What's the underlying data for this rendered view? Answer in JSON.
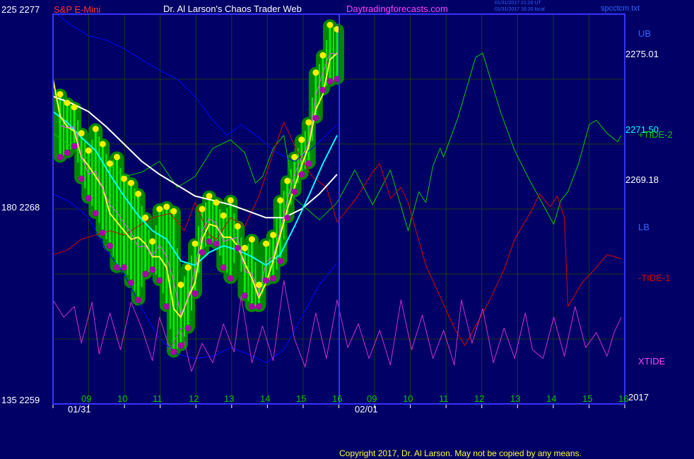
{
  "header": {
    "scale_top": "225  2277",
    "instrument": "S&P E-Mini",
    "site_title": "Dr. Al Larson's Chaos Trader Web",
    "site_url": "Daytradingforecasts.com",
    "timestamp_1": "01/31/2017 21:20 UT",
    "timestamp_2": "01/31/2017 16:20 local",
    "filename": "spcctcm.txt"
  },
  "left_scale": {
    "mid": "180  2268",
    "bottom": "135  2259"
  },
  "right_labels": {
    "ub": "UB",
    "ub_value": "2275.01",
    "mid_value_1": "2271.50",
    "tide2": "+TIDE-2",
    "mid_value_2": "2269.18",
    "lb": "LB",
    "tide1": "-TIDE-1",
    "xtide": "XTIDE",
    "year": "2017"
  },
  "x_axis": {
    "hours": [
      "09",
      "10",
      "11",
      "12",
      "13",
      "14",
      "15",
      "16",
      "09",
      "10",
      "11",
      "12",
      "13",
      "14",
      "15",
      "16"
    ],
    "date_1": "01/31",
    "date_2": "02/01"
  },
  "footer": {
    "copyright": "Copyright 2017, Dr. Al Larson. May not be copied by any means."
  },
  "colors": {
    "background": "#000066",
    "grid": "#1e3d10",
    "frame": "#3333ff",
    "price_glow": "#008800",
    "price_bars": "#00ee00",
    "highs": "#ffee00",
    "lows": "#aa00aa",
    "ema_fast": "#ffff33",
    "ema_mid": "#00ffff",
    "ema_slow": "#ffffff",
    "bands": "#0000ff",
    "tide2": "#00cc00",
    "tide1": "#dd0000",
    "xtide": "#cc33cc"
  },
  "chart_data": {
    "type": "line",
    "instrument": "S&P E-Mini",
    "y_axis": {
      "min": 2259,
      "max": 2277,
      "ticks": [
        2259,
        2268,
        2277
      ],
      "alt_ticks": [
        135,
        180,
        225
      ]
    },
    "x_axis": {
      "unit": "hour",
      "start": 8,
      "end": 16.1,
      "forecast_start": 16,
      "forecast_end": 24.1
    },
    "price_highs": [
      [
        8.2,
        2273.3
      ],
      [
        8.4,
        2272.9
      ],
      [
        8.6,
        2272.7
      ],
      [
        8.8,
        2271.5
      ],
      [
        9.0,
        2270.7
      ],
      [
        9.2,
        2271.7
      ],
      [
        9.4,
        2271.0
      ],
      [
        9.6,
        2270.1
      ],
      [
        9.8,
        2270.4
      ],
      [
        10.0,
        2269.4
      ],
      [
        10.2,
        2269.2
      ],
      [
        10.4,
        2268.7
      ],
      [
        10.6,
        2267.6
      ],
      [
        10.8,
        2266.5
      ],
      [
        11.0,
        2268.0
      ],
      [
        11.2,
        2268.1
      ],
      [
        11.4,
        2267.9
      ],
      [
        11.6,
        2264.5
      ],
      [
        11.8,
        2265.3
      ],
      [
        12.0,
        2266.4
      ],
      [
        12.2,
        2268.0
      ],
      [
        12.4,
        2268.6
      ],
      [
        12.6,
        2268.3
      ],
      [
        12.8,
        2267.7
      ],
      [
        13.0,
        2268.4
      ],
      [
        13.2,
        2267.2
      ],
      [
        13.4,
        2266.2
      ],
      [
        13.6,
        2266.6
      ],
      [
        13.8,
        2264.5
      ],
      [
        14.0,
        2266.4
      ],
      [
        14.2,
        2266.8
      ],
      [
        14.4,
        2268.4
      ],
      [
        14.6,
        2269.3
      ],
      [
        14.8,
        2270.4
      ],
      [
        15.0,
        2271.2
      ],
      [
        15.2,
        2272.0
      ],
      [
        15.4,
        2274.3
      ],
      [
        15.6,
        2275.1
      ],
      [
        15.8,
        2276.5
      ],
      [
        16.0,
        2276.3
      ]
    ],
    "price_lows": [
      [
        8.2,
        2270.4
      ],
      [
        8.4,
        2270.6
      ],
      [
        8.6,
        2270.9
      ],
      [
        8.8,
        2269.4
      ],
      [
        9.0,
        2268.5
      ],
      [
        9.2,
        2267.8
      ],
      [
        9.4,
        2266.9
      ],
      [
        9.6,
        2266.3
      ],
      [
        9.8,
        2265.3
      ],
      [
        10.0,
        2265.3
      ],
      [
        10.2,
        2264.6
      ],
      [
        10.4,
        2263.8
      ],
      [
        10.6,
        2265.0
      ],
      [
        10.8,
        2265.2
      ],
      [
        11.0,
        2264.7
      ],
      [
        11.2,
        2263.5
      ],
      [
        11.4,
        2261.4
      ],
      [
        11.6,
        2261.7
      ],
      [
        11.8,
        2262.5
      ],
      [
        12.0,
        2264.1
      ],
      [
        12.2,
        2266.0
      ],
      [
        12.4,
        2266.5
      ],
      [
        12.6,
        2266.4
      ],
      [
        12.8,
        2265.3
      ],
      [
        13.0,
        2264.8
      ],
      [
        13.2,
        2266.2
      ],
      [
        13.4,
        2264.0
      ],
      [
        13.6,
        2263.5
      ],
      [
        13.8,
        2263.5
      ],
      [
        14.0,
        2264.7
      ],
      [
        14.2,
        2264.8
      ],
      [
        14.4,
        2265.6
      ],
      [
        14.6,
        2267.6
      ],
      [
        14.8,
        2268.8
      ],
      [
        15.0,
        2269.6
      ],
      [
        15.2,
        2270.1
      ],
      [
        15.4,
        2272.2
      ],
      [
        15.6,
        2273.5
      ],
      [
        15.8,
        2273.9
      ],
      [
        16.0,
        2274.0
      ]
    ],
    "ema_fast": [
      [
        8.0,
        2274.0
      ],
      [
        8.2,
        2272.3
      ],
      [
        8.4,
        2271.8
      ],
      [
        8.6,
        2271.6
      ],
      [
        8.8,
        2270.4
      ],
      [
        9.0,
        2270.0
      ],
      [
        9.2,
        2269.5
      ],
      [
        9.4,
        2269.0
      ],
      [
        9.6,
        2267.8
      ],
      [
        9.8,
        2267.4
      ],
      [
        10.0,
        2267.0
      ],
      [
        10.2,
        2266.6
      ],
      [
        10.4,
        2266.7
      ],
      [
        10.6,
        2266.4
      ],
      [
        10.8,
        2265.8
      ],
      [
        11.0,
        2265.8
      ],
      [
        11.2,
        2265.3
      ],
      [
        11.4,
        2263.4
      ],
      [
        11.6,
        2263.0
      ],
      [
        11.8,
        2263.9
      ],
      [
        12.0,
        2264.6
      ],
      [
        12.2,
        2266.6
      ],
      [
        12.4,
        2267.3
      ],
      [
        12.6,
        2267.2
      ],
      [
        12.8,
        2266.7
      ],
      [
        13.0,
        2266.7
      ],
      [
        13.2,
        2266.3
      ],
      [
        13.4,
        2265.5
      ],
      [
        13.6,
        2264.8
      ],
      [
        13.8,
        2263.9
      ],
      [
        14.0,
        2264.6
      ],
      [
        14.2,
        2265.6
      ],
      [
        14.4,
        2266.8
      ],
      [
        14.6,
        2268.0
      ],
      [
        14.8,
        2269.0
      ],
      [
        15.0,
        2270.0
      ],
      [
        15.2,
        2270.9
      ],
      [
        15.4,
        2272.6
      ],
      [
        15.6,
        2273.3
      ],
      [
        15.8,
        2274.9
      ],
      [
        16.0,
        2275.2
      ]
    ],
    "ema_mid": [
      [
        8.0,
        2272.5
      ],
      [
        8.4,
        2272.0
      ],
      [
        8.8,
        2271.3
      ],
      [
        9.2,
        2270.7
      ],
      [
        9.6,
        2269.6
      ],
      [
        10.0,
        2268.6
      ],
      [
        10.4,
        2267.7
      ],
      [
        10.8,
        2267.0
      ],
      [
        11.2,
        2266.6
      ],
      [
        11.6,
        2265.6
      ],
      [
        12.0,
        2265.4
      ],
      [
        12.4,
        2266.0
      ],
      [
        12.8,
        2266.3
      ],
      [
        13.2,
        2266.1
      ],
      [
        13.6,
        2265.8
      ],
      [
        14.0,
        2265.4
      ],
      [
        14.4,
        2265.9
      ],
      [
        14.8,
        2267.2
      ],
      [
        15.2,
        2268.6
      ],
      [
        15.6,
        2270.1
      ],
      [
        16.0,
        2271.4
      ]
    ],
    "ema_slow": [
      [
        8.0,
        2273.2
      ],
      [
        8.5,
        2272.9
      ],
      [
        9.0,
        2272.5
      ],
      [
        9.5,
        2271.8
      ],
      [
        10.0,
        2271.0
      ],
      [
        10.5,
        2270.2
      ],
      [
        11.0,
        2269.6
      ],
      [
        11.5,
        2269.1
      ],
      [
        12.0,
        2268.6
      ],
      [
        12.5,
        2268.4
      ],
      [
        13.0,
        2268.2
      ],
      [
        13.5,
        2267.9
      ],
      [
        14.0,
        2267.6
      ],
      [
        14.5,
        2267.6
      ],
      [
        15.0,
        2268.0
      ],
      [
        15.5,
        2268.7
      ],
      [
        16.0,
        2269.6
      ]
    ],
    "upper_band": [
      [
        8.1,
        2277.0
      ],
      [
        8.5,
        2276.5
      ],
      [
        9.0,
        2276.0
      ],
      [
        9.5,
        2275.8
      ],
      [
        10.0,
        2275.4
      ],
      [
        10.5,
        2274.9
      ],
      [
        11.0,
        2274.4
      ],
      [
        11.5,
        2274.0
      ],
      [
        12.0,
        2273.2
      ],
      [
        12.5,
        2272.1
      ],
      [
        12.9,
        2271.4
      ],
      [
        13.3,
        2271.9
      ],
      [
        13.8,
        2271.3
      ],
      [
        14.3,
        2270.6
      ],
      [
        14.8,
        2270.2
      ],
      [
        15.3,
        2270.8
      ],
      [
        16.0,
        2271.9
      ]
    ],
    "lower_band": [
      [
        8.0,
        2268.7
      ],
      [
        8.5,
        2268.3
      ],
      [
        9.0,
        2267.6
      ],
      [
        9.5,
        2266.1
      ],
      [
        10.0,
        2265.0
      ],
      [
        10.5,
        2263.4
      ],
      [
        11.0,
        2262.0
      ],
      [
        11.5,
        2261.3
      ],
      [
        12.0,
        2261.1
      ],
      [
        12.5,
        2261.2
      ],
      [
        13.0,
        2261.6
      ],
      [
        13.5,
        2261.3
      ],
      [
        14.0,
        2260.9
      ],
      [
        14.5,
        2261.5
      ],
      [
        15.0,
        2263.0
      ],
      [
        15.5,
        2264.5
      ],
      [
        16.0,
        2265.5
      ]
    ],
    "tide2": [
      [
        8.0,
        2271.5
      ],
      [
        9.0,
        2270.3
      ],
      [
        9.6,
        2270.0
      ],
      [
        10.0,
        2269.5
      ],
      [
        10.5,
        2269.7
      ],
      [
        11.0,
        2270.2
      ],
      [
        11.5,
        2269.0
      ],
      [
        12.0,
        2269.5
      ],
      [
        12.5,
        2270.8
      ],
      [
        13.0,
        2271.2
      ],
      [
        13.4,
        2270.6
      ],
      [
        13.7,
        2269.2
      ],
      [
        13.9,
        2269.5
      ],
      [
        14.2,
        2270.8
      ],
      [
        14.5,
        2271.4
      ],
      [
        14.8,
        2268.5
      ],
      [
        15.5,
        2267.5
      ],
      [
        16.0,
        2268.3
      ],
      [
        16.5,
        2269.8
      ],
      [
        17.0,
        2268.2
      ],
      [
        17.5,
        2269.8
      ],
      [
        18.0,
        2267.0
      ],
      [
        18.3,
        2268.8
      ],
      [
        18.5,
        2268.3
      ],
      [
        18.7,
        2270.0
      ],
      [
        18.9,
        2270.8
      ],
      [
        19.0,
        2270.4
      ],
      [
        19.4,
        2272.2
      ],
      [
        19.9,
        2275.0
      ],
      [
        20.1,
        2275.2
      ],
      [
        20.6,
        2272.5
      ],
      [
        21.0,
        2270.7
      ],
      [
        21.4,
        2269.4
      ],
      [
        21.8,
        2268.2
      ],
      [
        22.1,
        2267.3
      ],
      [
        22.3,
        2268.4
      ],
      [
        22.5,
        2268.8
      ],
      [
        22.8,
        2270.1
      ],
      [
        23.1,
        2271.9
      ],
      [
        23.3,
        2272.1
      ],
      [
        23.6,
        2271.5
      ],
      [
        23.9,
        2271.1
      ],
      [
        24.0,
        2271.4
      ]
    ],
    "tide1": [
      [
        8.0,
        2265.9
      ],
      [
        8.4,
        2266.1
      ],
      [
        8.8,
        2266.6
      ],
      [
        9.2,
        2266.8
      ],
      [
        9.6,
        2267.0
      ],
      [
        10.0,
        2266.8
      ],
      [
        10.4,
        2267.2
      ],
      [
        10.8,
        2267.6
      ],
      [
        11.3,
        2267.8
      ],
      [
        11.7,
        2267.0
      ],
      [
        12.0,
        2268.3
      ],
      [
        12.4,
        2266.8
      ],
      [
        12.6,
        2266.6
      ],
      [
        13.0,
        2267.6
      ],
      [
        13.4,
        2267.2
      ],
      [
        13.8,
        2268.6
      ],
      [
        14.2,
        2270.6
      ],
      [
        14.5,
        2272.0
      ],
      [
        14.9,
        2270.6
      ],
      [
        15.3,
        2269.5
      ],
      [
        15.7,
        2269.0
      ],
      [
        16.0,
        2267.4
      ],
      [
        16.5,
        2268.4
      ],
      [
        17.0,
        2269.7
      ],
      [
        17.2,
        2270.1
      ],
      [
        17.5,
        2268.5
      ],
      [
        17.8,
        2269.0
      ],
      [
        18.0,
        2268.3
      ],
      [
        18.5,
        2265.4
      ],
      [
        19.0,
        2263.6
      ],
      [
        19.3,
        2262.5
      ],
      [
        19.6,
        2261.7
      ],
      [
        19.9,
        2262.6
      ],
      [
        20.3,
        2263.8
      ],
      [
        20.7,
        2265.2
      ],
      [
        21.0,
        2266.6
      ],
      [
        21.5,
        2268.0
      ],
      [
        21.7,
        2268.7
      ],
      [
        22.0,
        2268.1
      ],
      [
        22.2,
        2268.6
      ],
      [
        22.4,
        2267.6
      ],
      [
        22.5,
        2263.5
      ],
      [
        22.9,
        2264.6
      ],
      [
        23.3,
        2265.3
      ],
      [
        23.6,
        2265.9
      ],
      [
        24.0,
        2265.7
      ]
    ],
    "xtide": [
      [
        8.0,
        2263.8
      ],
      [
        8.3,
        2263.0
      ],
      [
        8.6,
        2263.5
      ],
      [
        8.8,
        2261.8
      ],
      [
        9.1,
        2263.7
      ],
      [
        9.3,
        2261.3
      ],
      [
        9.6,
        2263.2
      ],
      [
        9.9,
        2261.5
      ],
      [
        10.2,
        2263.7
      ],
      [
        10.5,
        2262.5
      ],
      [
        10.8,
        2261.0
      ],
      [
        11.0,
        2263.0
      ],
      [
        11.3,
        2261.5
      ],
      [
        11.6,
        2262.5
      ],
      [
        11.9,
        2260.5
      ],
      [
        12.2,
        2261.8
      ],
      [
        12.5,
        2260.9
      ],
      [
        12.8,
        2262.7
      ],
      [
        13.1,
        2261.4
      ],
      [
        13.3,
        2264.0
      ],
      [
        13.6,
        2260.9
      ],
      [
        13.9,
        2262.6
      ],
      [
        14.2,
        2261.0
      ],
      [
        14.5,
        2264.7
      ],
      [
        14.8,
        2262.0
      ],
      [
        15.1,
        2260.7
      ],
      [
        15.4,
        2263.2
      ],
      [
        15.7,
        2261.1
      ],
      [
        16.0,
        2263.8
      ],
      [
        16.3,
        2261.6
      ],
      [
        16.6,
        2262.7
      ],
      [
        16.9,
        2261.1
      ],
      [
        17.2,
        2262.4
      ],
      [
        17.5,
        2260.8
      ],
      [
        17.8,
        2263.8
      ],
      [
        18.1,
        2261.5
      ],
      [
        18.4,
        2263.1
      ],
      [
        18.7,
        2261.1
      ],
      [
        19.0,
        2262.4
      ],
      [
        19.3,
        2260.8
      ],
      [
        19.5,
        2263.8
      ],
      [
        19.8,
        2261.8
      ],
      [
        20.1,
        2263.4
      ],
      [
        20.4,
        2260.9
      ],
      [
        20.7,
        2262.5
      ],
      [
        21.0,
        2261.1
      ],
      [
        21.3,
        2263.2
      ],
      [
        21.5,
        2261.5
      ],
      [
        21.8,
        2261.1
      ],
      [
        22.1,
        2263.0
      ],
      [
        22.4,
        2261.2
      ],
      [
        22.7,
        2263.5
      ],
      [
        23.0,
        2261.6
      ],
      [
        23.3,
        2262.3
      ],
      [
        23.6,
        2261.2
      ],
      [
        23.8,
        2262.3
      ],
      [
        24.0,
        2263.0
      ]
    ]
  }
}
